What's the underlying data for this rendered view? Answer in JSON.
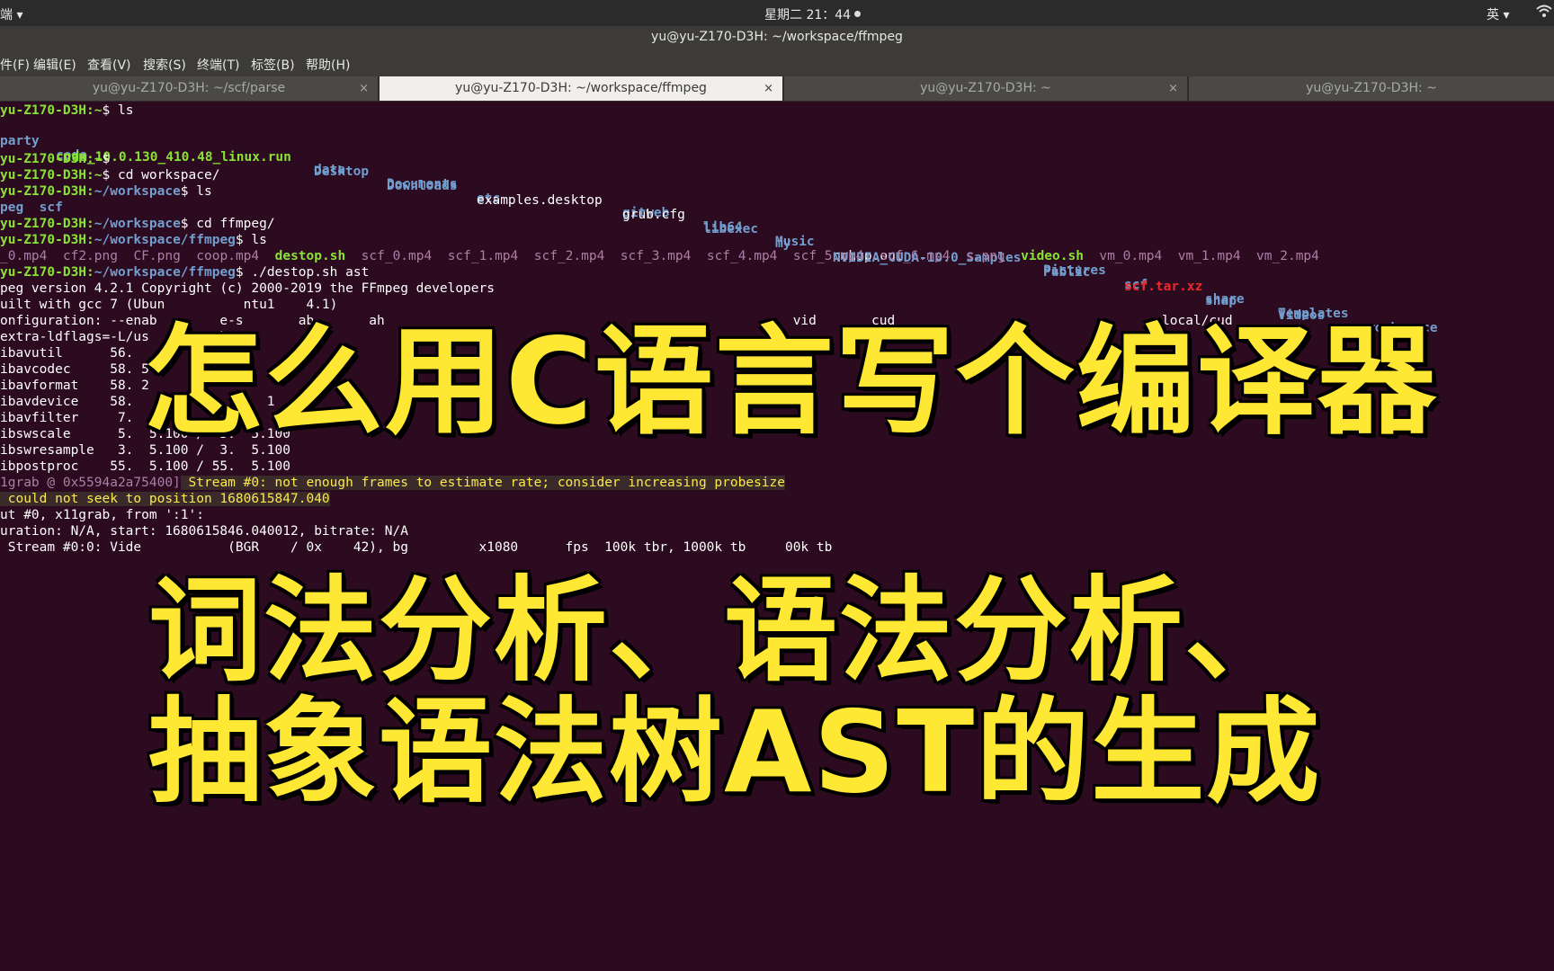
{
  "topbar": {
    "app_label": "端 ▾",
    "clock": "星期二 21：44",
    "ime": "英 ▾",
    "wifi_icon": "wifi-icon"
  },
  "window_title": "yu@yu-Z170-D3H: ~/workspace/ffmpeg",
  "menu": [
    "件(F)",
    "编辑(E)",
    "查看(V)",
    "搜索(S)",
    "终端(T)",
    "标签(B)",
    "帮助(H)"
  ],
  "tabs": [
    {
      "label": "yu@yu-Z170-D3H: ~/scf/parse",
      "close": "×"
    },
    {
      "label": "yu@yu-Z170-D3H: ~/workspace/ffmpeg",
      "close": "×"
    },
    {
      "label": "yu@yu-Z170-D3H: ~",
      "close": "×"
    },
    {
      "label": "yu@yu-Z170-D3H: ~",
      "close": ""
    }
  ],
  "terminal": {
    "line1_prompt": "yu-Z170-D3H:~",
    "line1_cmd": "$ ls",
    "ls_row1": [
      {
        "t": "party",
        "c": "b"
      },
      {
        "t": "code",
        "c": "b"
      },
      {
        "t": "data",
        "c": "b"
      },
      {
        "t": "Documents",
        "c": "b"
      },
      {
        "t": "etc",
        "c": "b"
      },
      {
        "t": "gitweb",
        "c": "b"
      },
      {
        "t": "lib64",
        "c": "b"
      },
      {
        "t": "Music",
        "c": "b"
      },
      {
        "t": "nohup.out",
        "c": ""
      },
      {
        "t": "Pictures",
        "c": "b"
      },
      {
        "t": "scf",
        "c": "b"
      },
      {
        "t": "share",
        "c": "b"
      },
      {
        "t": "Templates",
        "c": "b"
      },
      {
        "t": "workspace",
        "c": "b"
      }
    ],
    "ls_row2": [
      {
        "t": "cuda_10.0.130_410.48_linux.run",
        "c": "g"
      },
      {
        "t": "Desktop",
        "c": "b"
      },
      {
        "t": "Downloads",
        "c": "b"
      },
      {
        "t": "examples.desktop",
        "c": ""
      },
      {
        "t": "grub.cfg",
        "c": ""
      },
      {
        "t": "libexec",
        "c": "b"
      },
      {
        "t": "my",
        "c": "b"
      },
      {
        "t": "NVIDIA_CUDA-10.0_Samples",
        "c": "b"
      },
      {
        "t": "Public",
        "c": "b"
      },
      {
        "t": "scf.tar.xz",
        "c": "r"
      },
      {
        "t": "snap",
        "c": "b"
      },
      {
        "t": "Videos",
        "c": "b"
      }
    ],
    "line4_prompt": "yu-Z170-D3H:~",
    "line4_cmd": "$",
    "line5_prompt": "yu-Z170-D3H:~",
    "line5_cmd": "$ cd workspace/",
    "line6_prompt": "yu-Z170-D3H:",
    "line6_path": "~/workspace",
    "line6_cmd": "$ ls",
    "ls_row3": [
      {
        "t": "peg",
        "c": "b"
      },
      {
        "t": "scf",
        "c": "b"
      }
    ],
    "line8_prompt": "yu-Z170-D3H:",
    "line8_path": "~/workspace",
    "line8_cmd": "$ cd ffmpeg/",
    "line9_prompt": "yu-Z170-D3H:",
    "line9_path": "~/workspace/ffmpeg",
    "line9_cmd": "$ ls",
    "ls_row4": [
      {
        "t": "_0.mp4",
        "c": "m"
      },
      {
        "t": "cf2.png",
        "c": "m"
      },
      {
        "t": "CF.png",
        "c": "m"
      },
      {
        "t": "coop.mp4",
        "c": "m"
      },
      {
        "t": "destop.sh",
        "c": "g"
      },
      {
        "t": "scf_0.mp4",
        "c": "m"
      },
      {
        "t": "scf_1.mp4",
        "c": "m"
      },
      {
        "t": "scf_2.mp4",
        "c": "m"
      },
      {
        "t": "scf_3.mp4",
        "c": "m"
      },
      {
        "t": "scf_4.mp4",
        "c": "m"
      },
      {
        "t": "scf_5.mp4",
        "c": "m"
      },
      {
        "t": "scf_6.mp4",
        "c": "m"
      },
      {
        "t": "s.png",
        "c": "m"
      },
      {
        "t": "video.sh",
        "c": "g"
      },
      {
        "t": "vm_0.mp4",
        "c": "m"
      },
      {
        "t": "vm_1.mp4",
        "c": "m"
      },
      {
        "t": "vm_2.mp4",
        "c": "m"
      }
    ],
    "line11_prompt": "yu-Z170-D3H:",
    "line11_path": "~/workspace/ffmpeg",
    "line11_cmd": "$ ./destop.sh ast",
    "output": [
      "peg version 4.2.1 Copyright (c) 2000-2019 the FFmpeg developers",
      "uilt with gcc 7 (Ubun          ntu1    4.1)",
      "onfiguration: --enab        e-s       ab       ah                                                    vid       cud                                  local/cud",
      "extra-ldflags=-L/us        ab",
      "ibavutil      56.",
      "ibavcodec     58. 5",
      "ibavformat    58. 2",
      "ibavdevice    58.                 1",
      "ibavfilter     7.",
      "ibswscale      5.  5.100 /  5.  5.100",
      "ibswresample   3.  5.100 /  3.  5.100",
      "ibpostproc    55.  5.100 / 55.  5.100"
    ],
    "warn1_src": "1grab @ 0x5594a2a75400]",
    "warn1_msg": " Stream #0: not enough frames to estimate rate; consider increasing probesize",
    "warn2": " could not seek to position 1680615847.040",
    "output2": [
      "ut #0, x11grab, from ':1':",
      "uration: N/A, start: 1680615846.040012, bitrate: N/A",
      " Stream #0:0: Vide           (BGR    / 0x    42), bg         x1080      fps  100k tbr, 1000k tb     00k tb"
    ]
  },
  "overlay": {
    "title": "怎么用C语言写个编译器",
    "line2": "词法分析、语法分析、",
    "line3": "抽象语法树AST的生成"
  }
}
